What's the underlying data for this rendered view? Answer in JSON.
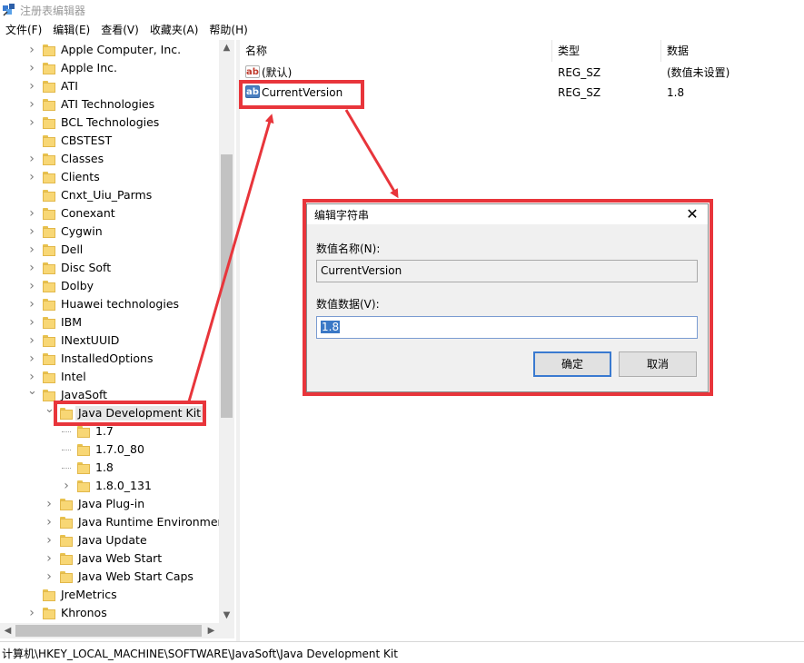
{
  "window": {
    "title": "注册表编辑器"
  },
  "menu": [
    "文件(F)",
    "编辑(E)",
    "查看(V)",
    "收藏夹(A)",
    "帮助(H)"
  ],
  "tree": {
    "root_items": [
      "Apple Computer, Inc.",
      "Apple Inc.",
      "ATI",
      "ATI Technologies",
      "BCL Technologies",
      "CBSTEST",
      "Classes",
      "Clients",
      "Cnxt_Uiu_Parms",
      "Conexant",
      "Cygwin",
      "Dell",
      "Disc Soft",
      "Dolby",
      "Huawei technologies",
      "IBM",
      "INextUUID",
      "InstalledOptions",
      "Intel"
    ],
    "javasoft": "JavaSoft",
    "jdk": "Java Development Kit",
    "jdk_children": [
      "1.7",
      "1.7.0_80",
      "1.8",
      "1.8.0_131"
    ],
    "javasoft_children": [
      "Java Plug-in",
      "Java Runtime Environment",
      "Java Update",
      "Java Web Start",
      "Java Web Start Caps"
    ],
    "after_items": [
      "JreMetrics",
      "Khronos"
    ]
  },
  "columns": {
    "name": "名称",
    "type": "类型",
    "data": "数据"
  },
  "values": [
    {
      "icon": "ab",
      "name": "(默认)",
      "type": "REG_SZ",
      "data": "(数值未设置)"
    },
    {
      "icon": "ab",
      "name": "CurrentVersion",
      "type": "REG_SZ",
      "data": "1.8"
    }
  ],
  "status": "计算机\\HKEY_LOCAL_MACHINE\\SOFTWARE\\JavaSoft\\Java Development Kit",
  "dialog": {
    "title": "编辑字符串",
    "close": "✕",
    "name_label": "数值名称(N):",
    "name_value": "CurrentVersion",
    "data_label": "数值数据(V):",
    "data_value": "1.8",
    "ok": "确定",
    "cancel": "取消"
  },
  "annotation_color": "#e8353b"
}
